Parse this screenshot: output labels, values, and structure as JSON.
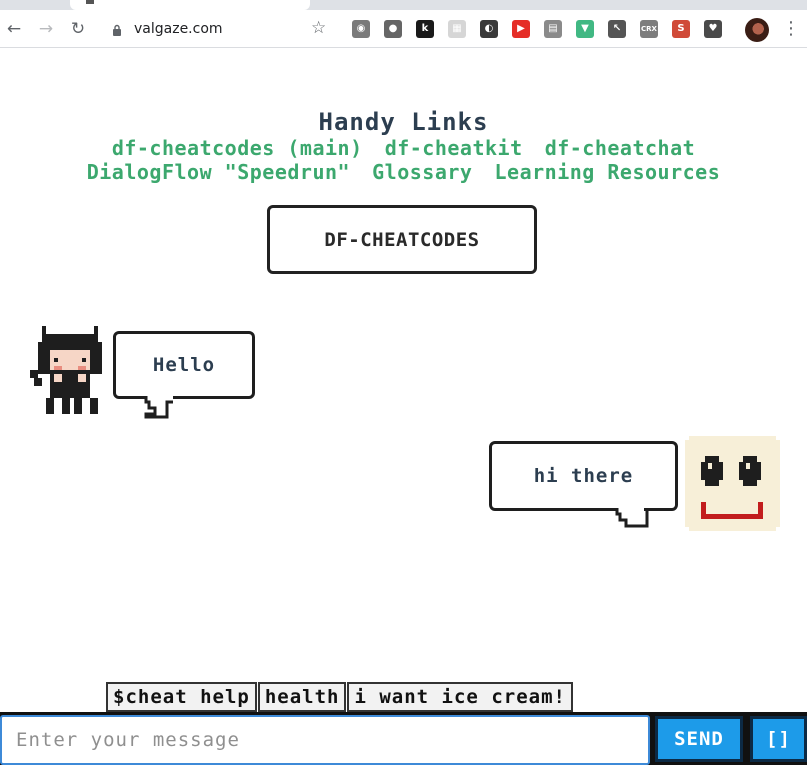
{
  "browser": {
    "url": "valgaze.com",
    "back_icon": "←",
    "forward_icon": "→",
    "reload_icon": "↻",
    "star_icon": "☆",
    "menu_icon": "⋮",
    "extensions": [
      {
        "name": "camera-ext",
        "glyph": "◉",
        "color": "#7a7a7a"
      },
      {
        "name": "onion-ext",
        "glyph": "●",
        "color": "#666666"
      },
      {
        "name": "k-ext",
        "glyph": "k",
        "color": "#1a1a1a"
      },
      {
        "name": "grid-ext",
        "glyph": "▦",
        "color": "#d6d6d6"
      },
      {
        "name": "moon-ext",
        "glyph": "◐",
        "color": "#3a3a3a"
      },
      {
        "name": "youtube-ext",
        "glyph": "▶",
        "color": "#e52d27"
      },
      {
        "name": "book-ext",
        "glyph": "▤",
        "color": "#8a8a8a"
      },
      {
        "name": "vue-ext",
        "glyph": "▼",
        "color": "#41b883"
      },
      {
        "name": "pointer-ext",
        "glyph": "↖",
        "color": "#555555"
      },
      {
        "name": "crx-ext",
        "glyph": "CRX",
        "color": "#7d7d7d"
      },
      {
        "name": "gitlens-ext",
        "glyph": "S",
        "color": "#d04a38"
      },
      {
        "name": "pocket-ext",
        "glyph": "♥",
        "color": "#4a4a4a"
      }
    ]
  },
  "header": {
    "title": "Handy Links",
    "links_row1": [
      "df-cheatcodes (main)",
      "df-cheatkit",
      "df-cheatchat"
    ],
    "links_row2": [
      "DialogFlow \"Speedrun\"",
      "Glossary",
      "Learning Resources"
    ]
  },
  "title_box": {
    "label": "DF-CHEATCODES"
  },
  "chat": {
    "bot_message": "Hello",
    "user_message": "hi there"
  },
  "quick_replies": [
    "$cheat help",
    "health",
    "i want ice cream!"
  ],
  "composer": {
    "placeholder": "Enter your message",
    "send_label": "SEND",
    "extra_label": "[]"
  },
  "colors": {
    "link_green": "#3ca86e",
    "title_dark": "#2c3e50",
    "send_blue": "#1d9be9"
  }
}
